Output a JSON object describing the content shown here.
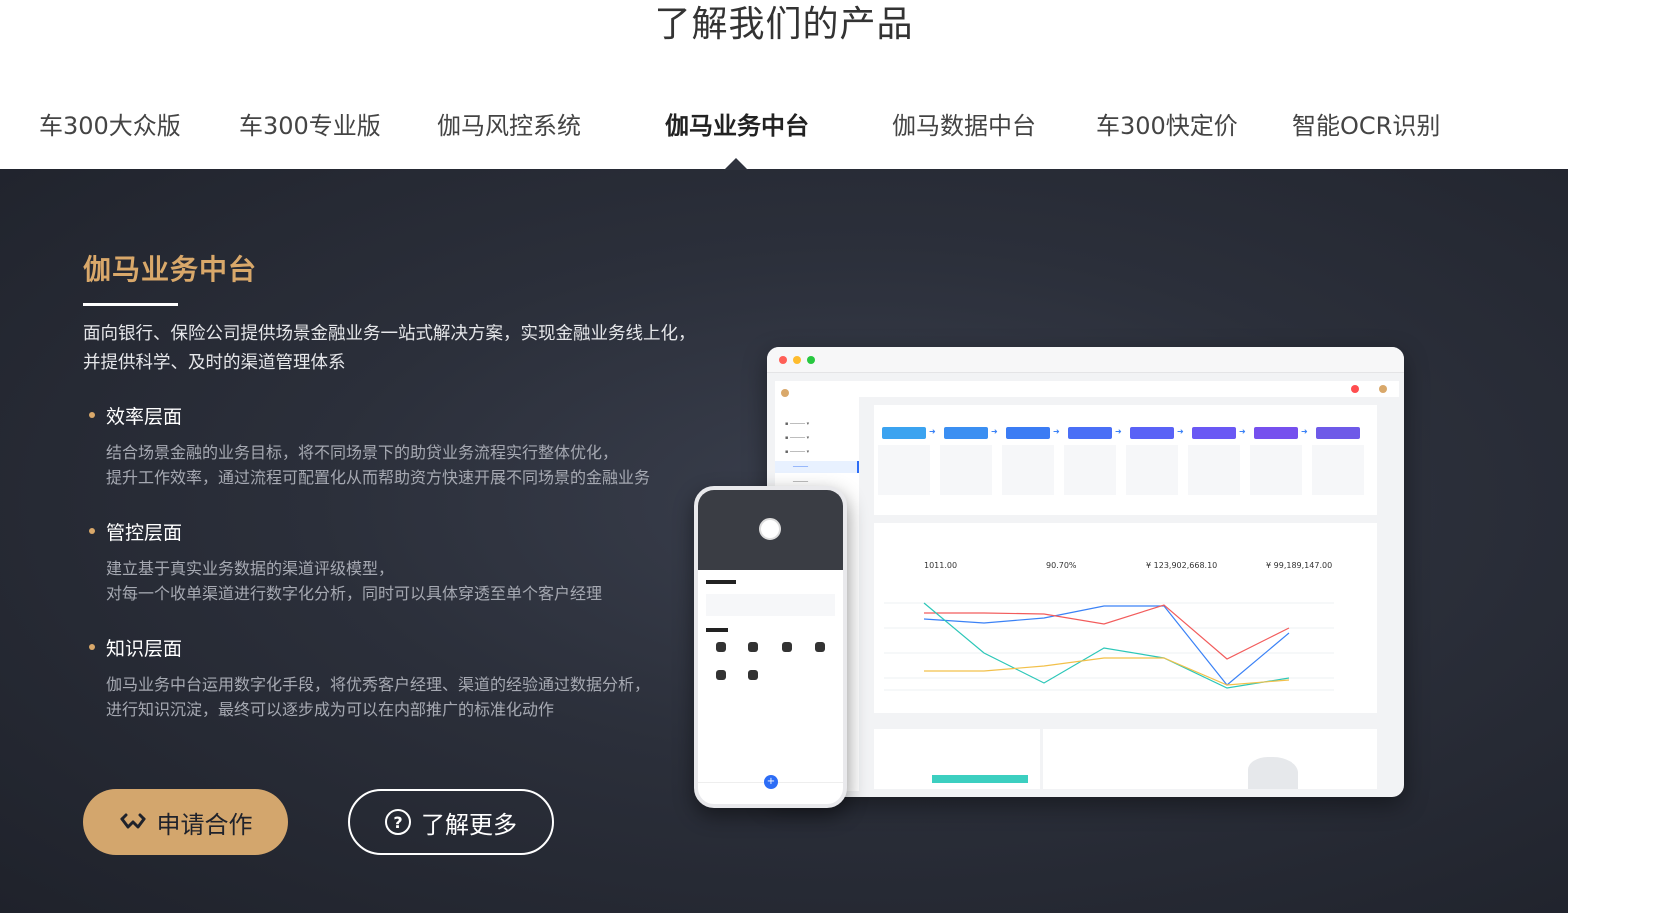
{
  "page_title": "了解我们的产品",
  "tabs": [
    {
      "label": "车300大众版",
      "active": false
    },
    {
      "label": "车300专业版",
      "active": false
    },
    {
      "label": "伽马风控系统",
      "active": false
    },
    {
      "label": "伽马业务中台",
      "active": true
    },
    {
      "label": "伽马数据中台",
      "active": false
    },
    {
      "label": "车300快定价",
      "active": false
    },
    {
      "label": "智能OCR识别",
      "active": false
    }
  ],
  "product": {
    "title": "伽马业务中台",
    "intro_line1": "面向银行、保险公司提供场景金融业务一站式解决方案，实现金融业务线上化，",
    "intro_line2": "并提供科学、及时的渠道管理体系",
    "sections": [
      {
        "heading": "效率层面",
        "line1": "结合场景金融的业务目标，将不同场景下的助贷业务流程实行整体优化，",
        "line2": "提升工作效率，通过流程可配置化从而帮助资方快速开展不同场景的金融业务"
      },
      {
        "heading": "管控层面",
        "line1": "建立基于真实业务数据的渠道评级模型，",
        "line2": "对每一个收单渠道进行数字化分析，同时可以具体穿透至单个客户经理"
      },
      {
        "heading": "知识层面",
        "line1": "伽马业务中台运用数字化手段，将优秀客户经理、渠道的经验通过数据分析，",
        "line2": "进行知识沉淀，最终可以逐步成为可以在内部推广的标准化动作"
      }
    ]
  },
  "buttons": {
    "apply": "申请合作",
    "more": "了解更多"
  },
  "dashboard": {
    "kpis": [
      "1011.00",
      "90.70%",
      "¥ 123,902,668.10",
      "¥ 99,189,147.00"
    ],
    "flow_colors": [
      "#3ba3f0",
      "#3b8ff2",
      "#3b7cf4",
      "#4a6ff6",
      "#5a62f6",
      "#6a58f4",
      "#7650ee",
      "#6e5ae8"
    ]
  },
  "colors": {
    "accent_gold": "#d9a86a",
    "panel_dark": "#2b2f3a",
    "button_gold": "#d3a66d"
  },
  "icons": {
    "apply": "handshake-icon",
    "more": "question-circle-icon"
  }
}
